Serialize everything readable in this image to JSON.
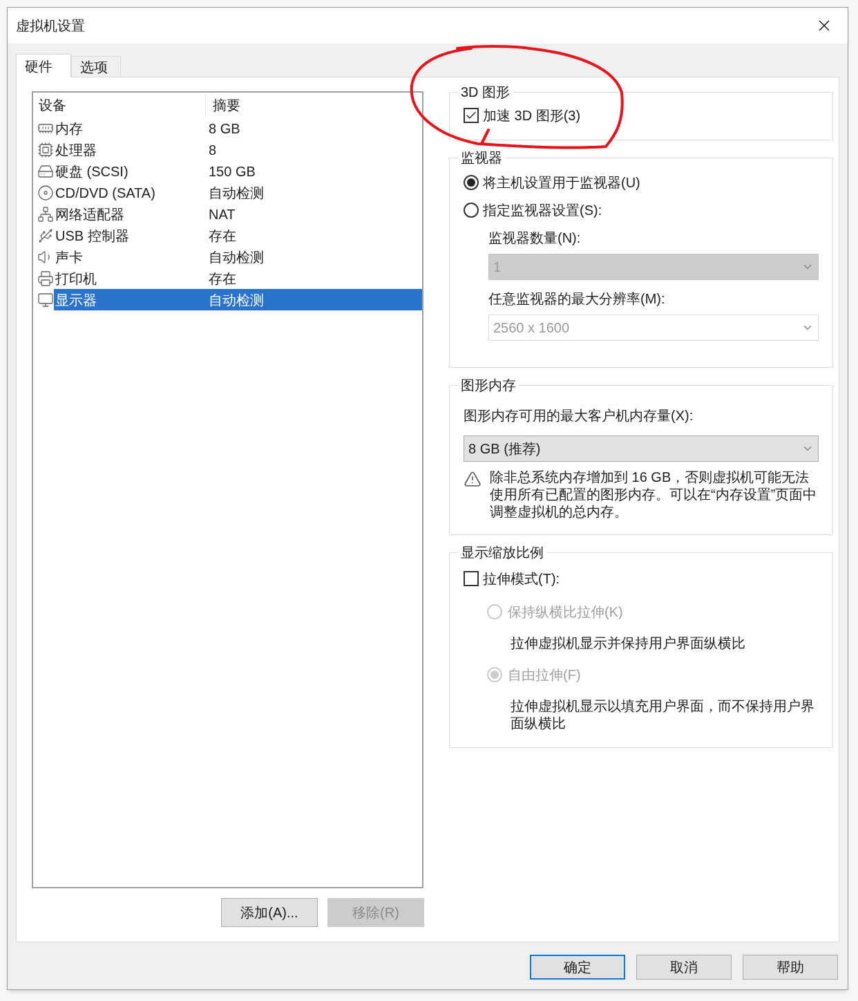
{
  "window": {
    "title": "虚拟机设置"
  },
  "tabs": [
    {
      "label": "硬件",
      "selected": true
    },
    {
      "label": "选项",
      "selected": false
    }
  ],
  "devices": {
    "columns": [
      "设备",
      "摘要"
    ],
    "rows": [
      {
        "kind": "memory",
        "device": "内存",
        "summary": "8 GB",
        "selected": false
      },
      {
        "kind": "cpu",
        "device": "处理器",
        "summary": "8",
        "selected": false
      },
      {
        "kind": "disk",
        "device": "硬盘 (SCSI)",
        "summary": "150 GB",
        "selected": false
      },
      {
        "kind": "cd",
        "device": "CD/DVD (SATA)",
        "summary": "自动检测",
        "selected": false
      },
      {
        "kind": "network",
        "device": "网络适配器",
        "summary": "NAT",
        "selected": false
      },
      {
        "kind": "usb",
        "device": "USB 控制器",
        "summary": "存在",
        "selected": false
      },
      {
        "kind": "sound",
        "device": "声卡",
        "summary": "自动检测",
        "selected": false
      },
      {
        "kind": "printer",
        "device": "打印机",
        "summary": "存在",
        "selected": false
      },
      {
        "kind": "display",
        "device": "显示器",
        "summary": "自动检测",
        "selected": true
      }
    ]
  },
  "device_buttons": [
    {
      "label": "添加(A)...",
      "disabled": false
    },
    {
      "label": "移除(R)",
      "disabled": true
    }
  ],
  "graphics_3d": {
    "title": "3D 图形",
    "accelerate": {
      "label": "加速 3D 图形(3)",
      "checked": true
    }
  },
  "monitors": {
    "title": "监视器",
    "options": [
      {
        "label": "将主机设置用于监视器(U)",
        "selected": true
      },
      {
        "label": "指定监视器设置(S):",
        "selected": false
      }
    ],
    "count": {
      "label": "监视器数量(N):",
      "value": "1",
      "disabled": true
    },
    "max_resolution": {
      "label": "任意监视器的最大分辨率(M):",
      "value": "2560 x 1600",
      "disabled": true
    }
  },
  "graphics_memory": {
    "title": "图形内存",
    "label": "图形内存可用的最大客户机内存量(X):",
    "value": "8 GB (推荐)",
    "warning": "除非总系统内存增加到 16 GB，否则虚拟机可能无法使用所有已配置的图形内存。可以在“内存设置”页面中调整虚拟机的总内存。"
  },
  "display_scaling": {
    "title": "显示缩放比例",
    "stretch": {
      "label": "拉伸模式(T):",
      "checked": false
    },
    "options": [
      {
        "label": "保持纵横比拉伸(K)",
        "description": "拉伸虚拟机显示并保持用户界面纵横比",
        "selected": false,
        "disabled": true
      },
      {
        "label": "自由拉伸(F)",
        "description": "拉伸虚拟机显示以填充用户界面，而不保持用户界面纵横比",
        "selected": true,
        "disabled": true
      }
    ]
  },
  "dialog_buttons": [
    {
      "label": "确定",
      "default": true
    },
    {
      "label": "取消",
      "default": false
    },
    {
      "label": "帮助",
      "default": false
    }
  ]
}
